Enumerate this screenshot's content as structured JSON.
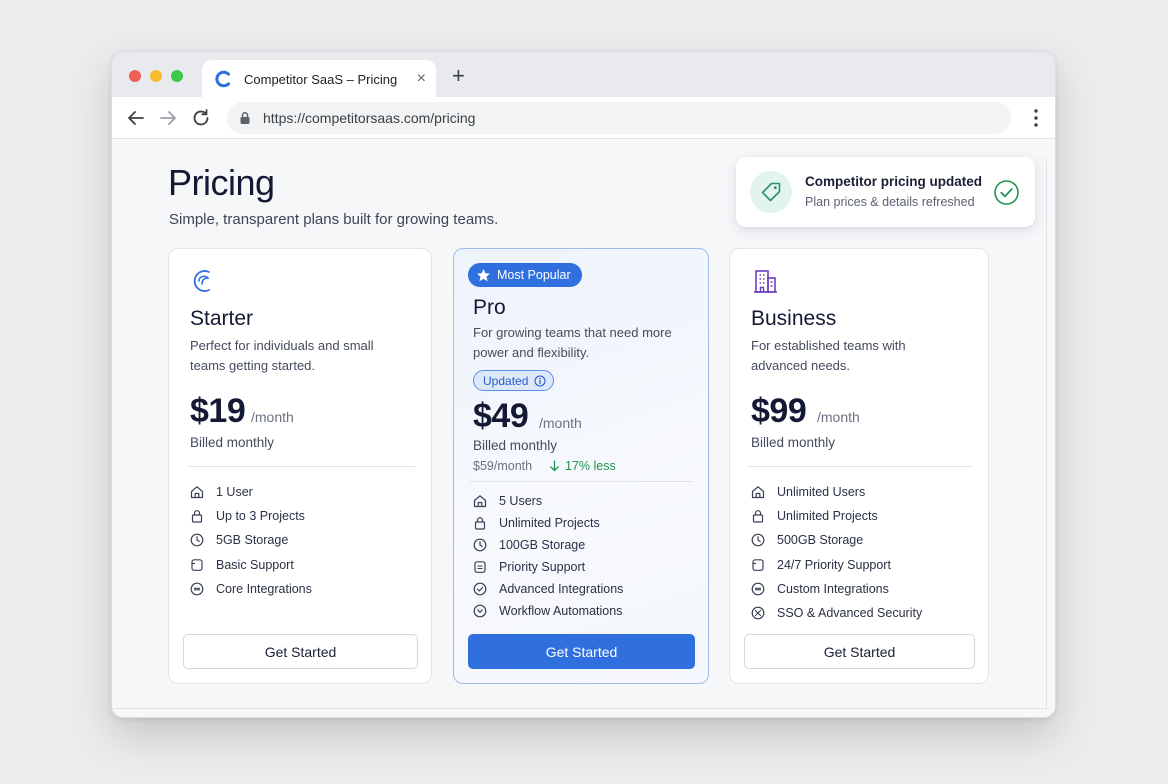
{
  "browser": {
    "tab_title": "Competitor SaaS – Pricing",
    "tab_close": "×",
    "new_tab": "+",
    "url": "https://competitorsaas.com/pricing"
  },
  "page": {
    "title": "Pricing",
    "subtitle": "Simple, transparent plans built for growing teams."
  },
  "toast": {
    "title": "Competitor pricing updated",
    "subtitle": "Plan prices & details refreshed",
    "icon": "tag-icon"
  },
  "colors": {
    "accent": "#2f6fde",
    "success": "#21944f",
    "toast_icon_bg": "#e3f4ec"
  },
  "plans": {
    "starter": {
      "name": "Starter",
      "description": "Perfect for individuals and small teams getting started.",
      "price": "$19",
      "period": "/month",
      "billing": "Billed monthly",
      "features": [
        "1 User",
        "Up to 3 Projects",
        "5GB Storage",
        "Basic Support",
        "Core Integrations"
      ],
      "cta": "Get Started"
    },
    "pro": {
      "badge": "Most Popular",
      "name": "Pro",
      "description": "For growing teams that need more power and flexibility.",
      "updated_badge": "Updated",
      "price": "$49",
      "period": "/month",
      "billing": "Billed monthly",
      "old_price": "$59/month",
      "price_change": "17% less",
      "features": [
        "5 Users",
        "Unlimited Projects",
        "100GB Storage",
        "Priority Support",
        "Advanced Integrations",
        "Workflow Automations"
      ],
      "cta": "Get Started"
    },
    "business": {
      "name": "Business",
      "description": "For established teams with advanced needs.",
      "price": "$99",
      "period": "/month",
      "billing": "Billed monthly",
      "features": [
        "Unlimited Users",
        "Unlimited Projects",
        "500GB Storage",
        "24/7 Priority Support",
        "Custom Integrations",
        "SSO & Advanced Security"
      ],
      "cta": "Get Started"
    }
  }
}
